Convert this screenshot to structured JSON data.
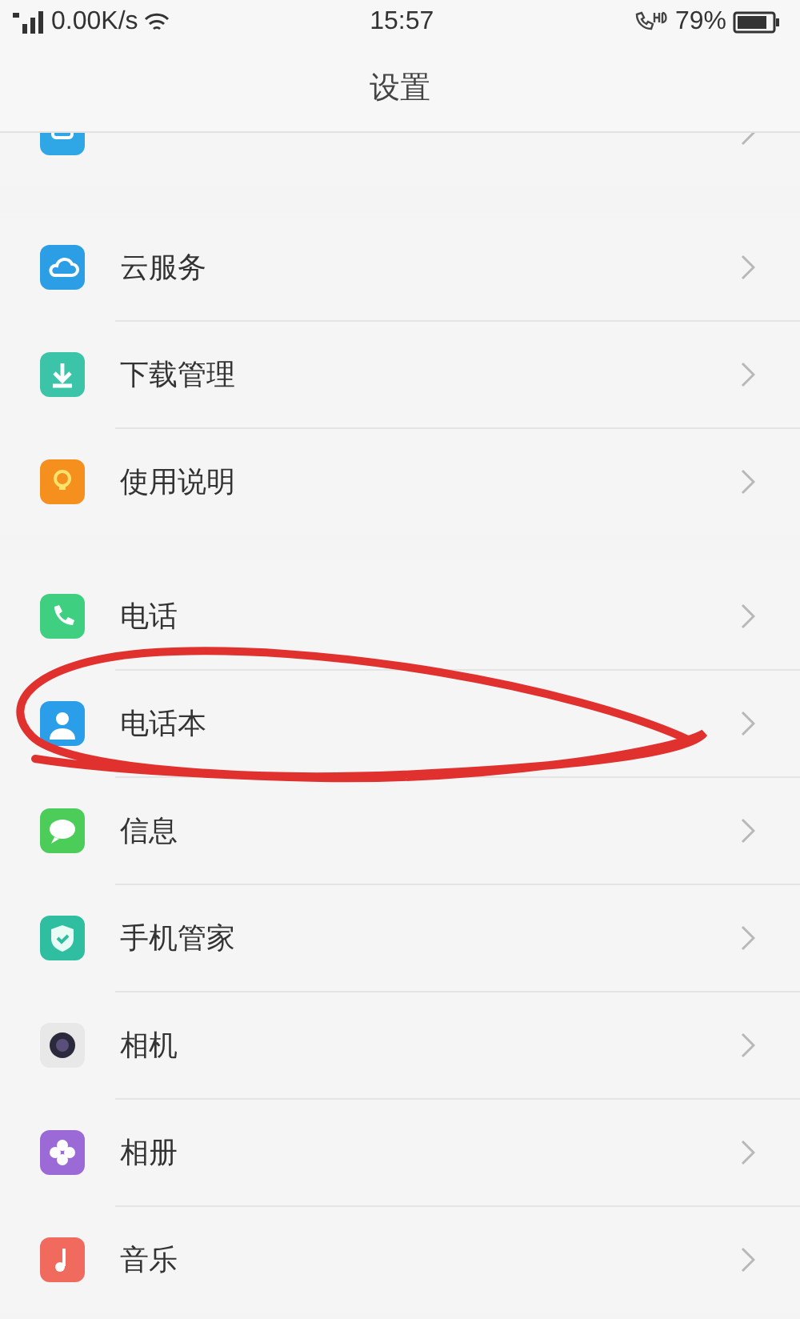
{
  "status_bar": {
    "network_speed": "0.00K/s",
    "time": "15:57",
    "battery": "79%"
  },
  "title": "设置",
  "groups": [
    {
      "items": [
        {
          "kind": "partial"
        }
      ]
    },
    {
      "items": [
        {
          "kind": "item",
          "label": "云服务"
        },
        {
          "kind": "item",
          "label": "下载管理"
        },
        {
          "kind": "item",
          "label": "使用说明"
        }
      ]
    },
    {
      "items": [
        {
          "kind": "item",
          "label": "电话"
        },
        {
          "kind": "item",
          "label": "电话本"
        },
        {
          "kind": "item",
          "label": "信息"
        },
        {
          "kind": "item",
          "label": "手机管家"
        },
        {
          "kind": "item",
          "label": "相机"
        },
        {
          "kind": "item",
          "label": "相册"
        },
        {
          "kind": "item",
          "label": "音乐"
        }
      ]
    }
  ]
}
